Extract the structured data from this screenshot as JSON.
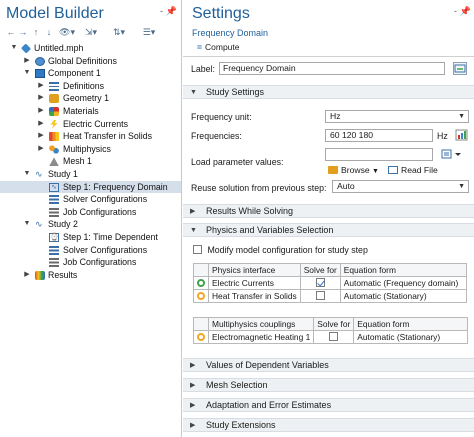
{
  "model_builder": {
    "title": "Model Builder",
    "pin": "‑ 📌",
    "toolbar": [
      "←",
      "→",
      "↑",
      "↓",
      "👁▾",
      "⇲▾",
      "⇅▾",
      "☰▾"
    ],
    "tree": [
      {
        "label": "Untitled.mph",
        "icon": "model-file-icon"
      },
      {
        "label": "Global Definitions",
        "icon": "global-definitions-icon"
      },
      {
        "label": "Component 1",
        "icon": "component-icon"
      },
      {
        "label": "Definitions",
        "icon": "definitions-icon"
      },
      {
        "label": "Geometry 1",
        "icon": "geometry-icon"
      },
      {
        "label": "Materials",
        "icon": "materials-icon"
      },
      {
        "label": "Electric Currents",
        "icon": "electric-currents-icon"
      },
      {
        "label": "Heat Transfer in Solids",
        "icon": "heat-transfer-icon"
      },
      {
        "label": "Multiphysics",
        "icon": "multiphysics-icon"
      },
      {
        "label": "Mesh 1",
        "icon": "mesh-icon"
      },
      {
        "label": "Study 1",
        "icon": "study-icon"
      },
      {
        "label": "Step 1: Frequency Domain",
        "icon": "frequency-domain-icon"
      },
      {
        "label": "Solver Configurations",
        "icon": "solver-configurations-icon"
      },
      {
        "label": "Job Configurations",
        "icon": "job-configurations-icon"
      },
      {
        "label": "Study 2",
        "icon": "study-icon"
      },
      {
        "label": "Step 1: Time Dependent",
        "icon": "time-dependent-icon"
      },
      {
        "label": "Solver Configurations",
        "icon": "solver-configurations-icon"
      },
      {
        "label": "Job Configurations",
        "icon": "job-configurations-icon"
      },
      {
        "label": "Results",
        "icon": "results-icon"
      }
    ]
  },
  "settings": {
    "title": "Settings",
    "pin": "‑ 📌",
    "subtitle": "Frequency Domain",
    "compute_label": "Compute",
    "label_caption": "Label:",
    "label_value": "Frequency Domain",
    "study_settings": {
      "header": "Study Settings",
      "frequency_unit_label": "Frequency unit:",
      "frequency_unit_value": "Hz",
      "frequencies_label": "Frequencies:",
      "frequencies_value": "60 120 180",
      "frequencies_unit": "Hz",
      "load_param_label": "Load parameter values:",
      "browse_label": "Browse",
      "read_file_label": "Read File",
      "reuse_label": "Reuse solution from previous step:",
      "reuse_value": "Auto"
    },
    "results_while_solving": "Results While Solving",
    "physics_selection": {
      "header": "Physics and Variables Selection",
      "modify_label": "Modify model configuration for study step",
      "physics_headers": [
        "Physics interface",
        "Solve for",
        "Equation form"
      ],
      "physics_rows": [
        {
          "name": "Electric Currents",
          "solve": true,
          "form": "Automatic (Frequency domain)",
          "color": "#4caf50"
        },
        {
          "name": "Heat Transfer in Solids",
          "solve": false,
          "form": "Automatic (Stationary)",
          "color": "#f5a623"
        }
      ],
      "multi_headers": [
        "Multiphysics couplings",
        "Solve for",
        "Equation form"
      ],
      "multi_rows": [
        {
          "name": "Electromagnetic Heating 1",
          "solve": false,
          "form": "Automatic (Stationary)"
        }
      ]
    },
    "collapsed_sections": [
      "Values of Dependent Variables",
      "Mesh Selection",
      "Adaptation and Error Estimates",
      "Study Extensions"
    ]
  }
}
